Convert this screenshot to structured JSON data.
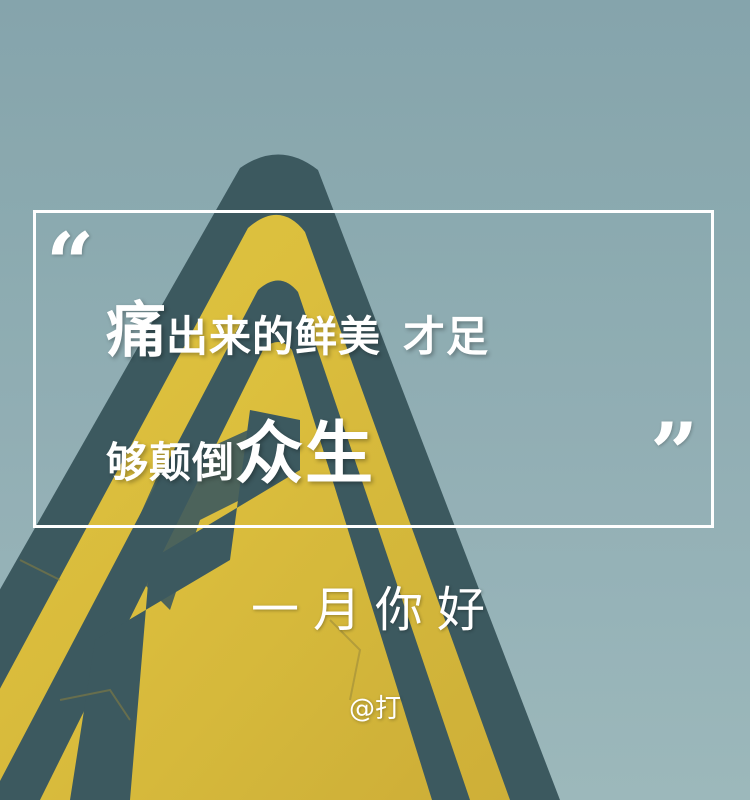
{
  "poster": {
    "quote_open": "“",
    "quote_close": "”",
    "line1": {
      "big": "痛",
      "rest": "出来的鲜美",
      "tail": "才足"
    },
    "line2": {
      "rest": "够颠倒",
      "big": "众生"
    },
    "subtitle": "一月你好",
    "author": "@打"
  },
  "colors": {
    "sky": "#86a8ae",
    "sign_yellow": "#d8b92a",
    "sign_border": "#2b4a52",
    "text": "#ffffff"
  }
}
